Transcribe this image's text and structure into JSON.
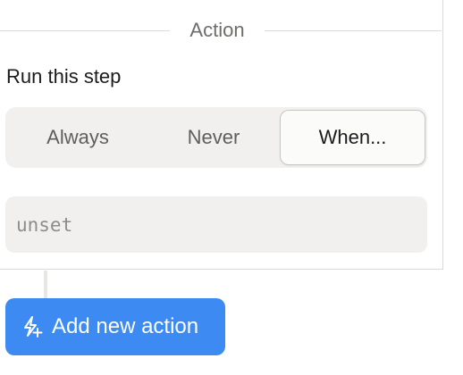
{
  "section": {
    "title": "Action"
  },
  "run_step": {
    "label": "Run this step",
    "options": [
      {
        "label": "Always",
        "selected": false
      },
      {
        "label": "Never",
        "selected": false
      },
      {
        "label": "When...",
        "selected": true
      }
    ]
  },
  "condition": {
    "value": "",
    "placeholder": "unset"
  },
  "add_action": {
    "label": "Add new action",
    "icon": "lightning-plus-icon",
    "color": "#3d8bf2"
  }
}
